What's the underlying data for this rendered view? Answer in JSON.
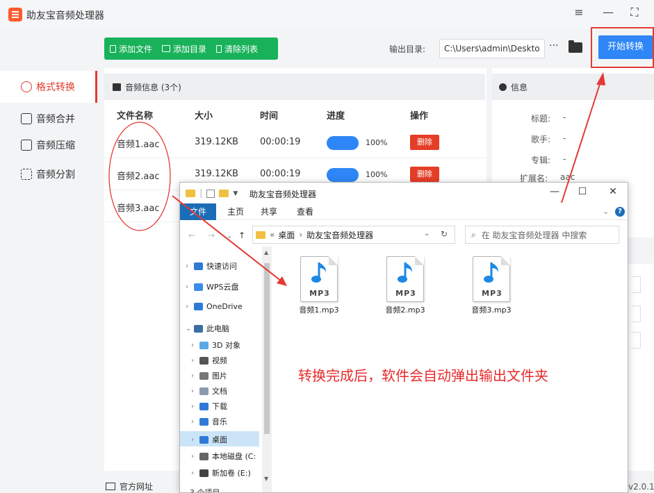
{
  "app": {
    "title": "助友宝音频处理器",
    "version": "v2.0.1"
  },
  "window_controls": {
    "menu": "≡",
    "minimize": "—",
    "maximize": "⛶"
  },
  "toolbar": {
    "add_file": "添加文件",
    "add_dir": "添加目录",
    "clear_list": "清除列表",
    "output_label": "输出目录:",
    "output_path": "C:\\Users\\admin\\Deskto",
    "more": "···",
    "start": "开始转换"
  },
  "sidebar": {
    "items": [
      {
        "label": "格式转换",
        "icon": "convert-icon"
      },
      {
        "label": "音频合并",
        "icon": "merge-icon"
      },
      {
        "label": "音频压缩",
        "icon": "compress-icon"
      },
      {
        "label": "音频分割",
        "icon": "split-icon"
      }
    ]
  },
  "list": {
    "header": "音频信息 (3个)",
    "columns": [
      "文件名称",
      "大小",
      "时间",
      "进度",
      "操作"
    ],
    "rows": [
      {
        "name": "音频1.aac",
        "size": "319.12KB",
        "time": "00:00:19",
        "progress": "100%",
        "action": "删除"
      },
      {
        "name": "音频2.aac",
        "size": "319.12KB",
        "time": "00:00:19",
        "progress": "100%",
        "action": "删除"
      },
      {
        "name": "音频3.aac"
      }
    ]
  },
  "info": {
    "header": "信息",
    "title_label": "标题:",
    "title_value": "-",
    "artist_label": "歌手:",
    "artist_value": "-",
    "album_label": "专辑:",
    "album_value": "-",
    "ext_label": "扩展名:",
    "ext_value": "aac"
  },
  "footer": {
    "website": "官方网址"
  },
  "explorer": {
    "title": "助友宝音频处理器",
    "tabs": [
      "文件",
      "主页",
      "共享",
      "查看"
    ],
    "address": [
      "桌面",
      "助友宝音频处理器"
    ],
    "address_prefix": "«",
    "search_placeholder": "在 助友宝音频处理器 中搜索",
    "tree": [
      {
        "label": "快速访问",
        "color": "#2f7ad6",
        "indent": 0,
        "arrow": ">"
      },
      {
        "label": "WPS云盘",
        "color": "#3a8ee6",
        "indent": 0,
        "arrow": ">"
      },
      {
        "label": "OneDrive",
        "color": "#2f7ad6",
        "indent": 0,
        "arrow": ">"
      },
      {
        "label": "此电脑",
        "color": "#3a6ea5",
        "indent": 0,
        "arrow": "v"
      },
      {
        "label": "3D 对象",
        "color": "#5aa9e6",
        "indent": 1,
        "arrow": ">"
      },
      {
        "label": "视频",
        "color": "#555555",
        "indent": 1,
        "arrow": ">"
      },
      {
        "label": "图片",
        "color": "#777777",
        "indent": 1,
        "arrow": ">"
      },
      {
        "label": "文档",
        "color": "#8a9bb0",
        "indent": 1,
        "arrow": ">"
      },
      {
        "label": "下载",
        "color": "#2f7ad6",
        "indent": 1,
        "arrow": ">"
      },
      {
        "label": "音乐",
        "color": "#2f7ad6",
        "indent": 1,
        "arrow": ">"
      },
      {
        "label": "桌面",
        "color": "#2f7ad6",
        "indent": 1,
        "arrow": ">"
      },
      {
        "label": "本地磁盘 (C:",
        "color": "#666666",
        "indent": 1,
        "arrow": ">"
      },
      {
        "label": "新加卷 (E:)",
        "color": "#444444",
        "indent": 1,
        "arrow": ">"
      }
    ],
    "files": [
      {
        "name": "音频1.mp3",
        "badge": "MP3"
      },
      {
        "name": "音频2.mp3",
        "badge": "MP3"
      },
      {
        "name": "音频3.mp3",
        "badge": "MP3"
      }
    ],
    "status": "3 个项目"
  },
  "annotation": "转换完成后，软件会自动弹出输出文件夹",
  "colors": {
    "green": "#19b25a",
    "blue": "#2f86f6",
    "red": "#e53935",
    "accent": "#e23b2e"
  }
}
